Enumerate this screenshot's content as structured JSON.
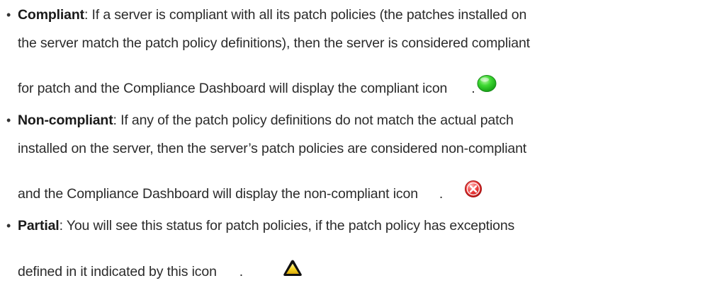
{
  "items": [
    {
      "term": "Compliant",
      "line1": ": If a server is compliant with all its patch policies (the patches installed on",
      "line2": "the server match the patch policy definitions), then the server is considered compliant",
      "line3": "for patch and the Compliance Dashboard will display the compliant icon",
      "icon": "green-circle-icon",
      "icon_color": "#22c41e",
      "end": "."
    },
    {
      "term": "Non-compliant",
      "line1": ": If any of the patch policy definitions do not match the actual patch",
      "line2": "installed on the server, then the server’s patch policies are considered non-compliant",
      "line3": "and the Compliance Dashboard will display the non-compliant icon",
      "icon": "red-x-circle-icon",
      "icon_color": "#e0262b",
      "end": "."
    },
    {
      "term": "Partial",
      "line1": ": You will see this status for patch policies, if the patch policy has exceptions",
      "line2": "defined in it indicated by this icon",
      "icon": "yellow-warning-triangle-icon",
      "icon_color": "#f2d21b",
      "end": "."
    }
  ],
  "bullet_char": "•"
}
